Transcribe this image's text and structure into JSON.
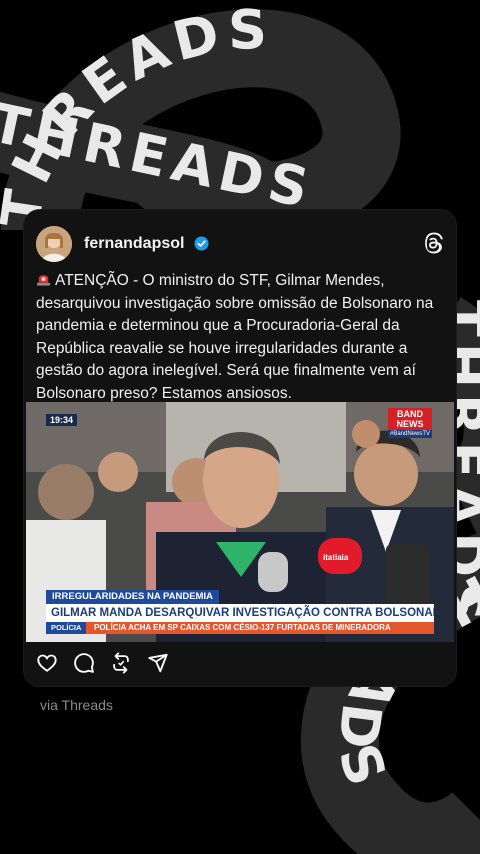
{
  "background": {
    "watermark_words": [
      "THREADS",
      "THREADS",
      "THREADS",
      "THREADS"
    ]
  },
  "post": {
    "username": "fernandapsol",
    "verified": true,
    "text": "ATENÇÃO - O ministro do STF, Gilmar Mendes, desarquivou investigação sobre omissão de Bolsonaro na pandemia e determinou que a Procuradoria-Geral da República reavalie se houve irregularidades durante a gestão do agora inelegível. Será que finalmente vem aí Bolsonaro preso? Estamos ansiosos.",
    "media": {
      "time": "19:34",
      "channel_logo_top": "BAND NEWS",
      "channel_logo_bottom": "#BandNewsTV",
      "tag": "IRREGULARIDADES NA PANDEMIA",
      "headline": "GILMAR MANDA DESARQUIVAR INVESTIGAÇÃO CONTRA BOLSONARO",
      "ticker_category": "POLÍCIA",
      "ticker_text": "POLÍCIA ACHA EM SP CAIXAS COM CÉSIO-137 FURTADAS DE MINERADORA",
      "mic_label": "itatiaia"
    },
    "actions": [
      "heart-icon",
      "comment-icon",
      "repost-icon",
      "share-icon"
    ]
  },
  "footer": {
    "via": "via Threads"
  },
  "colors": {
    "card_bg": "#121212",
    "verified_blue": "#1d9bf0",
    "band_red": "#d42027",
    "band_blue": "#1f4a9c",
    "ticker_orange": "#e4572e"
  }
}
